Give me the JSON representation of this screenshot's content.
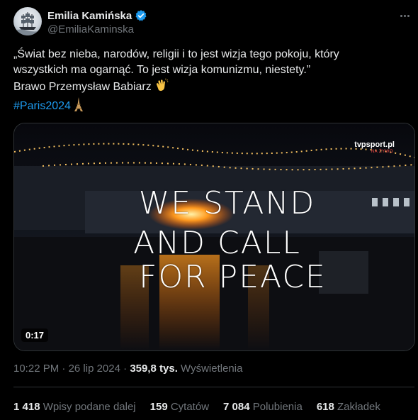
{
  "author": {
    "display_name": "Emilia Kamińska",
    "handle": "@EmiliaKaminska",
    "verified_color": "#1d9bf0"
  },
  "tweet": {
    "line1": "„Świat bez nieba, narodów, religii i to jest wizja tego pokoju, który",
    "line2": "wszystkich ma ogarnąć. To jest wizja komunizmu, niestety.”",
    "line3": "Brawo Przemysław Babiarz",
    "line3_emoji": "clapping-hands-icon",
    "hashtag": "#Paris2024",
    "hashtag_emoji": "eiffel-tower-icon"
  },
  "media": {
    "overlay_line1": "WE STAND",
    "overlay_line2": "AND CALL",
    "overlay_line3": "FOR PEACE",
    "watermark": "tvpsport.pl",
    "watermark_sub": "NA ŻYWO",
    "duration": "0:17"
  },
  "meta": {
    "time": "10:22 PM",
    "separator": "·",
    "date": "26 lip 2024",
    "separator2": "·",
    "views_count": "359,8 tys.",
    "views_label": "Wyświetlenia"
  },
  "stats": {
    "reposts_count": "1 418",
    "reposts_label": "Wpisy podane dalej",
    "quotes_count": "159",
    "quotes_label": "Cytatów",
    "likes_count": "7 084",
    "likes_label": "Polubienia",
    "bookmarks_count": "618",
    "bookmarks_label": "Zakładek"
  },
  "colors": {
    "background": "#000000",
    "text": "#e7e9ea",
    "muted": "#71767b",
    "link": "#1d9bf0",
    "divider": "#2f3336"
  }
}
